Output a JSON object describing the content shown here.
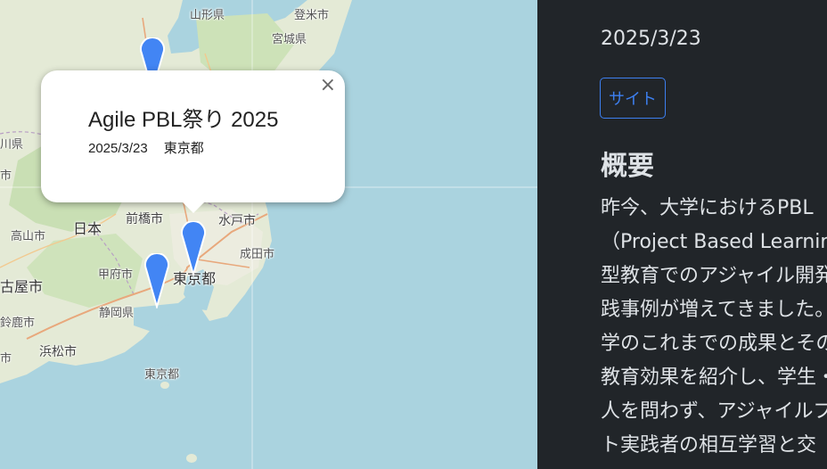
{
  "map": {
    "labels": {
      "yamagata": "山形県",
      "oboanazawa": "登米市",
      "miyagi": "宮城県",
      "kawaken": "川県",
      "shi": "市",
      "takayama": "高山市",
      "nihon": "日本",
      "maebashi": "前橋市",
      "mito": "水戸市",
      "narita": "成田市",
      "kofu": "甲府市",
      "tokyo_to": "東京都",
      "nagoya": "古屋市",
      "shizuoka": "静岡県",
      "suzuka": "鈴鹿市",
      "hamamatsu": "浜松市",
      "tokyo_to_sea": "東京都",
      "shi2": "市"
    }
  },
  "popup": {
    "title": "Agile PBL祭り 2025",
    "date": "2025/3/23",
    "location": "東京都",
    "close": "×"
  },
  "panel": {
    "date": "2025/3/23",
    "site_button": "サイト",
    "heading": "概要",
    "body_lines": [
      "昨今、大学におけるPBL",
      "（Project Based Learning）",
      "型教育でのアジャイル開発",
      "践事例が増えてきました。",
      "学のこれまでの成果とその",
      "教育効果を紹介し、学生・",
      "人を問わず、アジャイルプロ",
      "ト実践者の相互学習と交"
    ]
  },
  "colors": {
    "marker": "#4285f4",
    "button_accent": "#3d7fef",
    "panel_bg": "#212529",
    "sea": "#aad3df",
    "land": "#dfe7d0"
  }
}
